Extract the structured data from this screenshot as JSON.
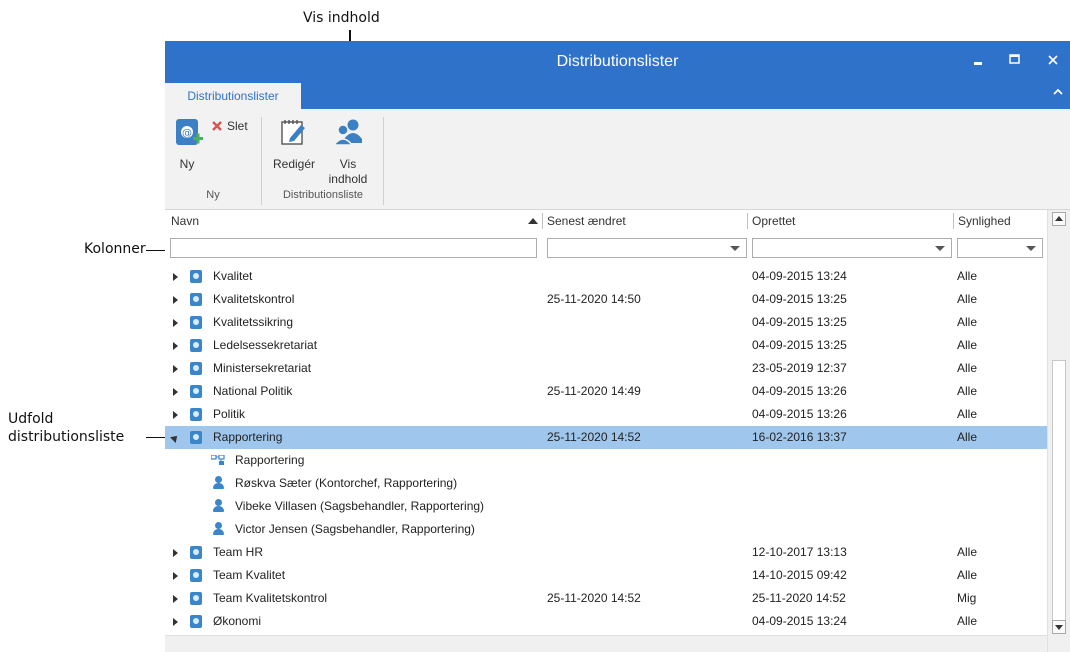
{
  "annotations": {
    "vis_indhold": "Vis indhold",
    "kolonner": "Kolonner",
    "udfold_line1": "Udfold",
    "udfold_line2": "distributionsliste"
  },
  "window": {
    "title": "Distributionslister",
    "minimize_icon": "minimize-icon",
    "maximize_icon": "maximize-icon",
    "close_icon": "close-icon"
  },
  "ribbon": {
    "tab": "Distributionslister",
    "buttons": {
      "ny": "Ny",
      "slet": "Slet",
      "rediger": "Redigér",
      "vis_line1": "Vis",
      "vis_line2": "indhold"
    },
    "groups": {
      "ny": "Ny",
      "distributionsliste": "Distributionsliste"
    }
  },
  "grid": {
    "columns": {
      "navn": "Navn",
      "senest": "Senest ændret",
      "oprettet": "Oprettet",
      "synlighed": "Synlighed"
    },
    "rows": [
      {
        "name": "Kvalitet",
        "changed": "",
        "created": "04-09-2015 13:24",
        "vis": "Alle"
      },
      {
        "name": "Kvalitetskontrol",
        "changed": "25-11-2020 14:50",
        "created": "04-09-2015 13:25",
        "vis": "Alle"
      },
      {
        "name": "Kvalitetssikring",
        "changed": "",
        "created": "04-09-2015 13:25",
        "vis": "Alle"
      },
      {
        "name": "Ledelsessekretariat",
        "changed": "",
        "created": "04-09-2015 13:25",
        "vis": "Alle"
      },
      {
        "name": "Ministersekretariat",
        "changed": "",
        "created": "23-05-2019 12:37",
        "vis": "Alle"
      },
      {
        "name": "National Politik",
        "changed": "25-11-2020 14:49",
        "created": "04-09-2015 13:26",
        "vis": "Alle"
      },
      {
        "name": "Politik",
        "changed": "",
        "created": "04-09-2015 13:26",
        "vis": "Alle"
      },
      {
        "name": "Rapportering",
        "changed": "25-11-2020 14:52",
        "created": "16-02-2016 13:37",
        "vis": "Alle"
      },
      {
        "name": "Team HR",
        "changed": "",
        "created": "12-10-2017 13:13",
        "vis": "Alle"
      },
      {
        "name": "Team Kvalitet",
        "changed": "",
        "created": "14-10-2015 09:42",
        "vis": "Alle"
      },
      {
        "name": "Team Kvalitetskontrol",
        "changed": "25-11-2020 14:52",
        "created": "25-11-2020 14:52",
        "vis": "Mig"
      },
      {
        "name": "Økonomi",
        "changed": "",
        "created": "04-09-2015 13:24",
        "vis": "Alle"
      }
    ],
    "children": [
      {
        "name": "Rapportering",
        "kind": "group"
      },
      {
        "name": "Røskva Sæter (Kontorchef, Rapportering)",
        "kind": "user"
      },
      {
        "name": "Vibeke Villasen (Sagsbehandler, Rapportering)",
        "kind": "user"
      },
      {
        "name": "Victor Jensen (Sagsbehandler, Rapportering)",
        "kind": "user"
      }
    ]
  }
}
